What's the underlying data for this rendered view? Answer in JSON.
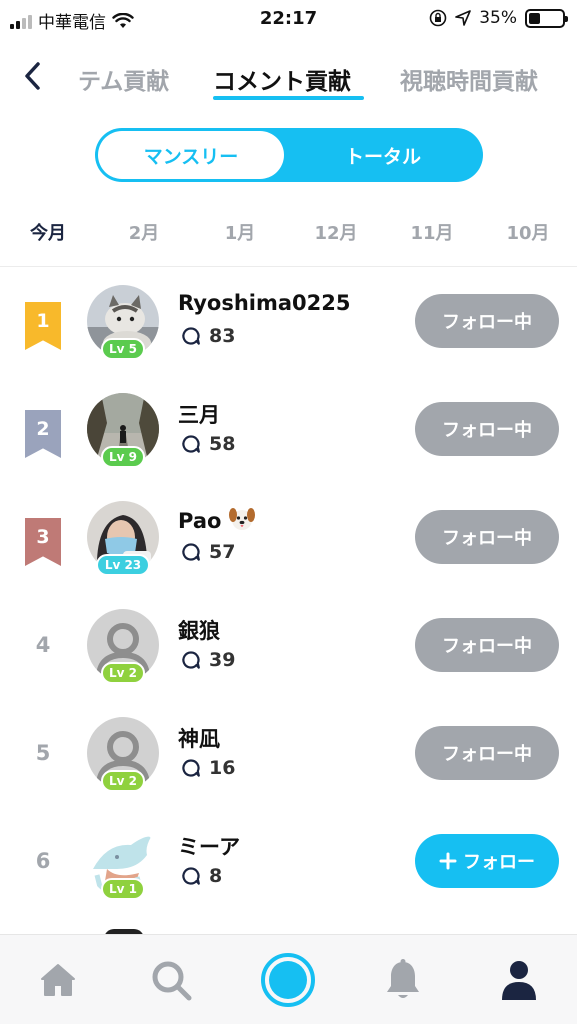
{
  "status_bar": {
    "carrier": "中華電信",
    "time": "22:17",
    "battery": "35%",
    "battery_level": 0.35
  },
  "tabs": [
    {
      "label": "テム貢献",
      "active": false
    },
    {
      "label": "コメント貢献",
      "active": true
    },
    {
      "label": "視聴時間貢献",
      "active": false
    }
  ],
  "segmented": {
    "options": [
      "マンスリー",
      "トータル"
    ],
    "selected": "マンスリー"
  },
  "months": [
    {
      "label": "今月",
      "active": true
    },
    {
      "label": "2月",
      "active": false
    },
    {
      "label": "1月",
      "active": false
    },
    {
      "label": "12月",
      "active": false
    },
    {
      "label": "11月",
      "active": false
    },
    {
      "label": "10月",
      "active": false
    }
  ],
  "ranking": [
    {
      "rank": "1",
      "name": "Ryoshima0225",
      "comments": "83",
      "level": "Lv 5",
      "button": "フォロー中",
      "following": true
    },
    {
      "rank": "2",
      "name": "三月",
      "comments": "58",
      "level": "Lv 9",
      "button": "フォロー中",
      "following": true
    },
    {
      "rank": "3",
      "name": "Pao",
      "comments": "57",
      "level": "Lv 23",
      "button": "フォロー中",
      "following": true
    },
    {
      "rank": "4",
      "name": "銀狼",
      "comments": "39",
      "level": "Lv 2",
      "button": "フォロー中",
      "following": true
    },
    {
      "rank": "5",
      "name": "神凪",
      "comments": "16",
      "level": "Lv 2",
      "button": "フォロー中",
      "following": true
    },
    {
      "rank": "6",
      "name": "ミーア",
      "comments": "8",
      "level": "Lv 1",
      "button": "フォロー",
      "following": false
    }
  ],
  "colors": {
    "accent": "#16bff2",
    "gold": "#f8b92b",
    "silver": "#9aa3bc",
    "bronze": "#bf7a76",
    "level_green": "#5bcb4e",
    "level_cyan": "#3ccfe0",
    "following_gray": "#a2a6ac"
  },
  "icons": {
    "back": "chevron-left-icon",
    "comment": "speech-bubble-icon",
    "nav": [
      "home-icon",
      "search-icon",
      "live-record-icon",
      "bell-icon",
      "profile-icon"
    ]
  }
}
